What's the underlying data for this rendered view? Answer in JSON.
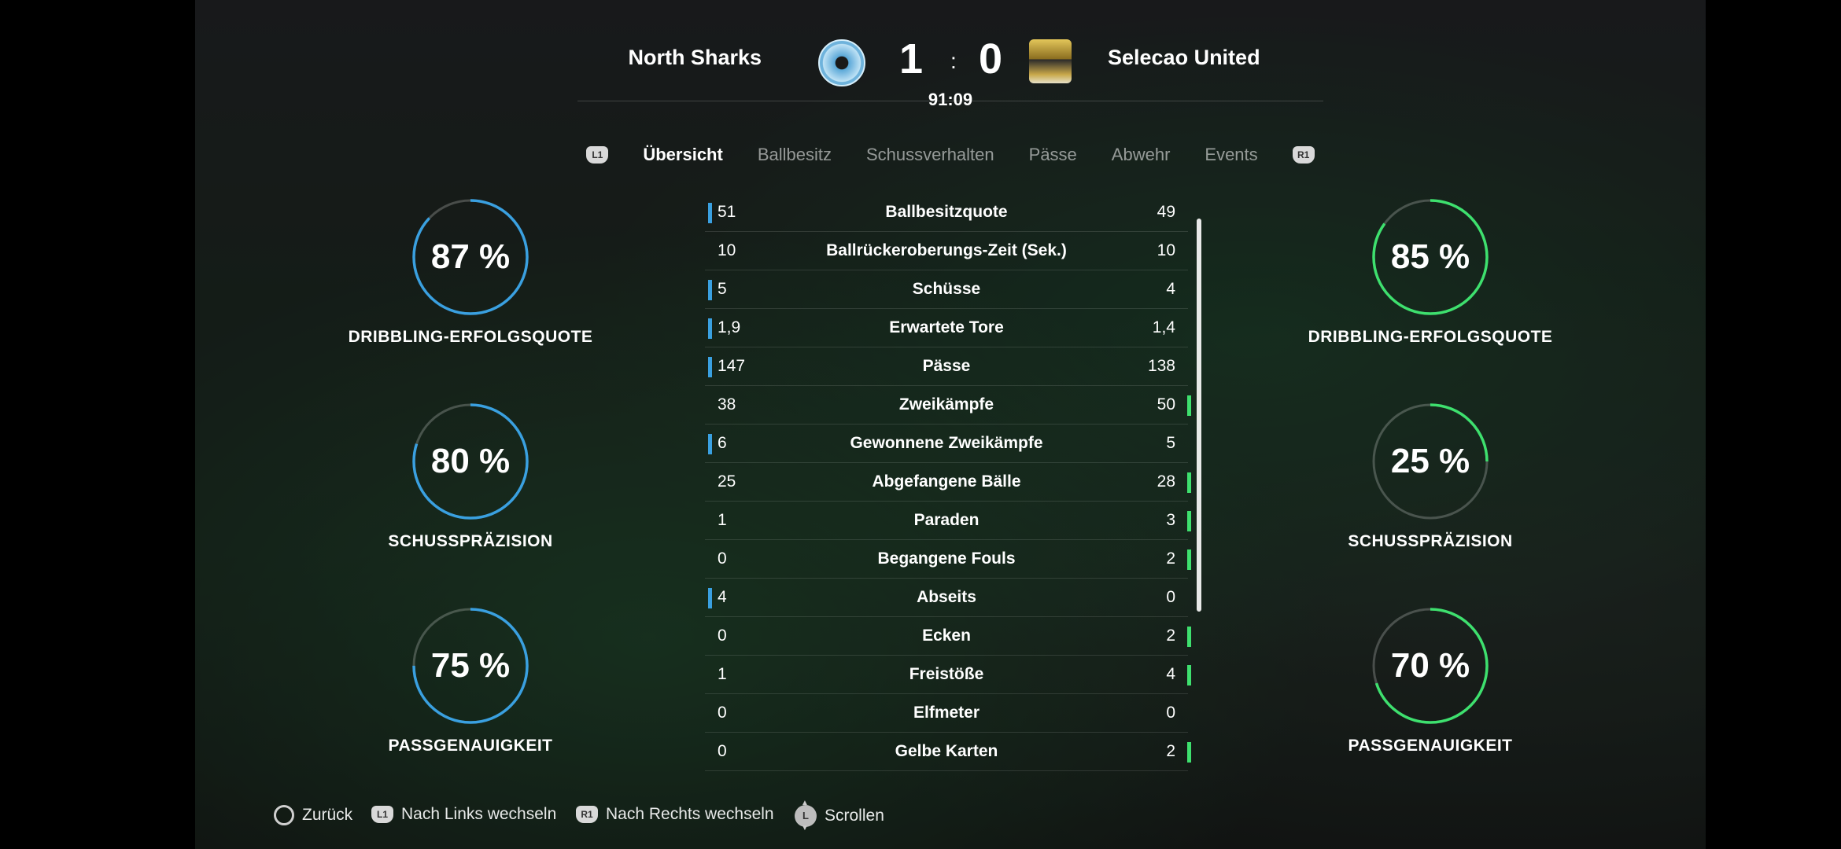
{
  "header": {
    "home_team": "North Sharks",
    "away_team": "Selecao United",
    "home_score": "1",
    "away_score": "0",
    "separator": ":",
    "clock": "91:09"
  },
  "tabs": {
    "left_button": "L1",
    "right_button": "R1",
    "items": [
      "Übersicht",
      "Ballbesitz",
      "Schussverhalten",
      "Pässe",
      "Abwehr",
      "Events"
    ],
    "active": "Übersicht"
  },
  "home_rings": [
    {
      "value": "87 %",
      "percent": 87,
      "label": "DRIBBLING-ERFOLGSQUOTE"
    },
    {
      "value": "80 %",
      "percent": 80,
      "label": "SCHUSSPRÄZISION"
    },
    {
      "value": "75 %",
      "percent": 75,
      "label": "PASSGENAUIGKEIT"
    }
  ],
  "away_rings": [
    {
      "value": "85 %",
      "percent": 85,
      "label": "DRIBBLING-ERFOLGSQUOTE"
    },
    {
      "value": "25 %",
      "percent": 25,
      "label": "SCHUSSPRÄZISION"
    },
    {
      "value": "70 %",
      "percent": 70,
      "label": "PASSGENAUIGKEIT"
    }
  ],
  "stats": [
    {
      "home": "51",
      "label": "Ballbesitzquote",
      "away": "49",
      "lead": "home"
    },
    {
      "home": "10",
      "label": "Ballrückeroberungs-Zeit (Sek.)",
      "away": "10",
      "lead": "none"
    },
    {
      "home": "5",
      "label": "Schüsse",
      "away": "4",
      "lead": "home"
    },
    {
      "home": "1,9",
      "label": "Erwartete Tore",
      "away": "1,4",
      "lead": "home"
    },
    {
      "home": "147",
      "label": "Pässe",
      "away": "138",
      "lead": "home"
    },
    {
      "home": "38",
      "label": "Zweikämpfe",
      "away": "50",
      "lead": "away"
    },
    {
      "home": "6",
      "label": "Gewonnene Zweikämpfe",
      "away": "5",
      "lead": "home"
    },
    {
      "home": "25",
      "label": "Abgefangene Bälle",
      "away": "28",
      "lead": "away"
    },
    {
      "home": "1",
      "label": "Paraden",
      "away": "3",
      "lead": "away"
    },
    {
      "home": "0",
      "label": "Begangene Fouls",
      "away": "2",
      "lead": "away"
    },
    {
      "home": "4",
      "label": "Abseits",
      "away": "0",
      "lead": "home"
    },
    {
      "home": "0",
      "label": "Ecken",
      "away": "2",
      "lead": "away"
    },
    {
      "home": "1",
      "label": "Freistöße",
      "away": "4",
      "lead": "away"
    },
    {
      "home": "0",
      "label": "Elfmeter",
      "away": "0",
      "lead": "none"
    },
    {
      "home": "0",
      "label": "Gelbe Karten",
      "away": "2",
      "lead": "away"
    }
  ],
  "footer": {
    "back": "Zurück",
    "l1_badge": "L1",
    "switch_left": "Nach Links wechseln",
    "r1_badge": "R1",
    "switch_right": "Nach Rechts wechseln",
    "stick_badge": "L",
    "scroll": "Scrollen"
  },
  "colors": {
    "home_accent": "#3aa0e0",
    "away_accent": "#3ee06e"
  }
}
